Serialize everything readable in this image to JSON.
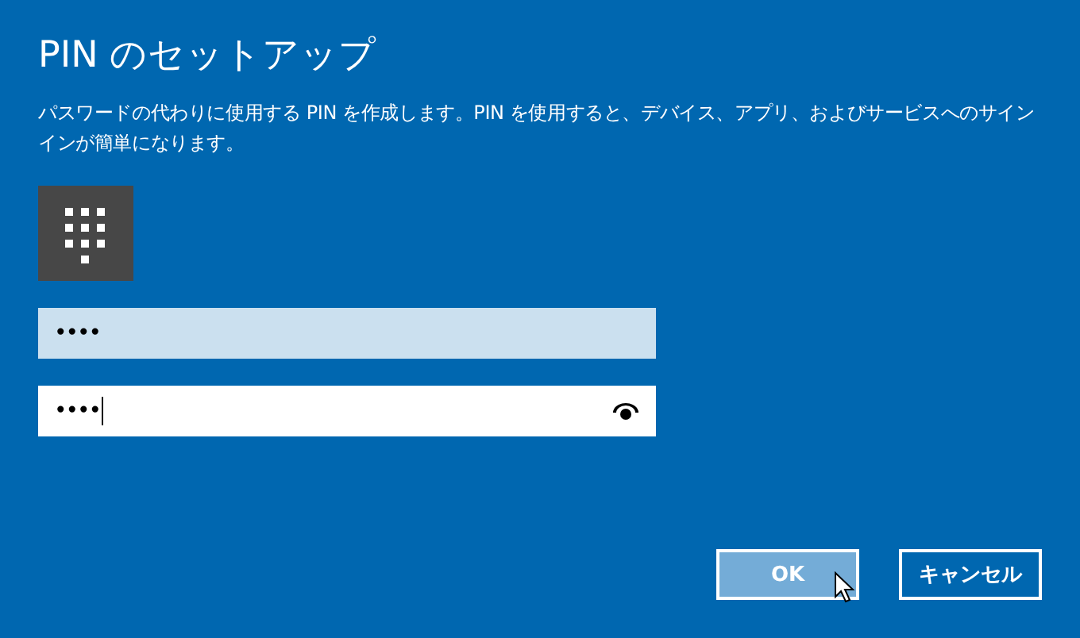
{
  "title": "PIN のセットアップ",
  "description": "パスワードの代わりに使用する PIN を作成します。PIN を使用すると、デバイス、アプリ、およびサービスへのサインインが簡単になります。",
  "fields": [
    {
      "value": "••••",
      "highlighted": true,
      "caret": false,
      "reveal_button": false
    },
    {
      "value": "••••",
      "highlighted": false,
      "caret": true,
      "reveal_button": true
    }
  ],
  "buttons": [
    {
      "label": "OK",
      "hovered": true
    },
    {
      "label": "キャンセル",
      "hovered": false
    }
  ]
}
